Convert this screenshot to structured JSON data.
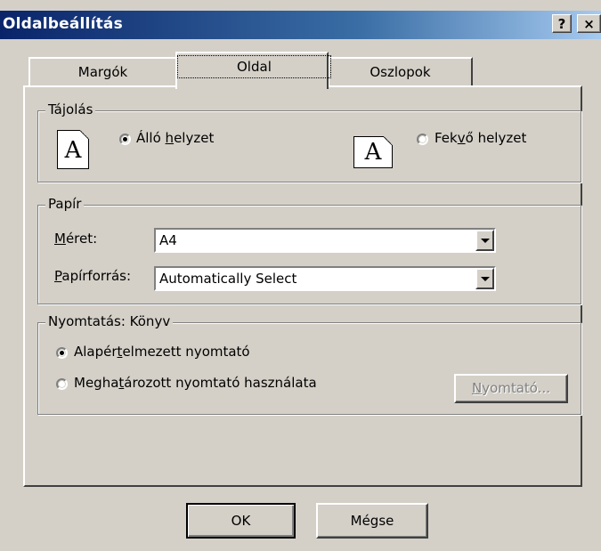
{
  "window": {
    "title": "Oldalbeállítás",
    "help_label": "?",
    "close_label": "×"
  },
  "tabs": [
    {
      "label": "Margók"
    },
    {
      "label": "Oldal"
    },
    {
      "label": "Oszlopok"
    }
  ],
  "orientation": {
    "legend": "Tájolás",
    "portrait": {
      "pre": "Álló ",
      "accel": "h",
      "post": "elyzet",
      "checked": true,
      "icon_glyph": "A"
    },
    "landscape": {
      "pre": "Fek",
      "accel": "v",
      "post": "ő helyzet",
      "checked": false,
      "icon_glyph": "A"
    }
  },
  "paper": {
    "legend": "Papír",
    "size_label": {
      "accel": "M",
      "post": "éret:"
    },
    "size_value": "A4",
    "source_label": {
      "accel": "P",
      "post": "apírforrás:"
    },
    "source_value": "Automatically Select"
  },
  "printing": {
    "legend": "Nyomtatás: Könyv",
    "default_printer": {
      "pre": "Alapér",
      "accel": "t",
      "post": "elmezett nyomtató",
      "checked": true
    },
    "specific_printer": {
      "pre": "Megha",
      "accel": "t",
      "post": "ározott nyomtató használata",
      "checked": false
    },
    "printer_button": {
      "accel": "N",
      "post": "yomtató..."
    }
  },
  "footer": {
    "ok_label": "OK",
    "cancel_label": "Mégse"
  }
}
